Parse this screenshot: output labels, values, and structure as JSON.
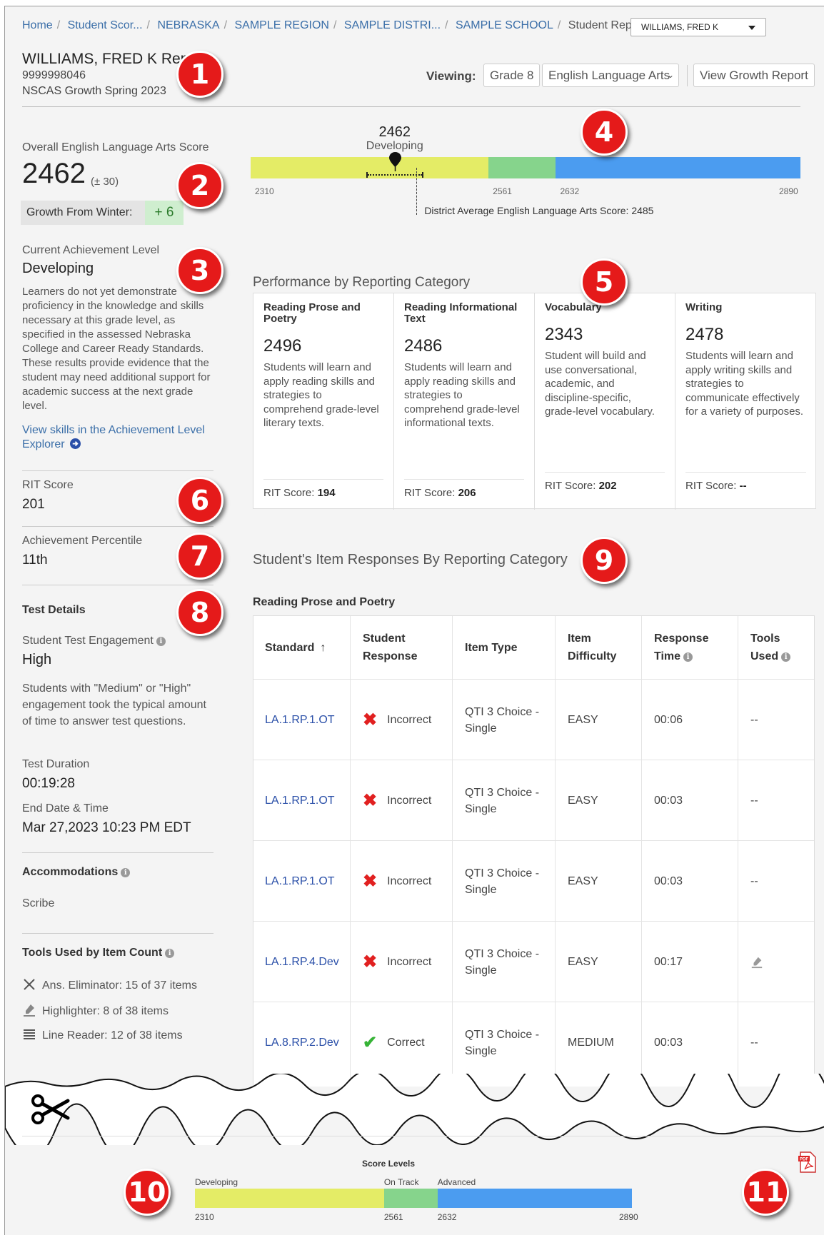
{
  "breadcrumb": [
    "Home",
    "Student Scor...",
    "NEBRASKA",
    "SAMPLE REGION",
    "SAMPLE DISTRI...",
    "SAMPLE SCHOOL"
  ],
  "breadcrumb_current": "Student Report:",
  "student_select": "WILLIAMS, FRED K",
  "header": {
    "title": "WILLIAMS, FRED K Report",
    "student_id": "9999998046",
    "test_name": "NSCAS Growth Spring 2023",
    "viewing_label": "Viewing:",
    "grade": "Grade 8",
    "subject": "English Language Arts",
    "growth_report_button": "View Growth Report"
  },
  "score": {
    "label": "Overall English Language Arts Score",
    "value": "2462",
    "error": "(± 30)",
    "growth_label": "Growth From Winter:",
    "growth_value": "+ 6",
    "marker_score": "2462",
    "marker_level": "Developing",
    "scale_min": 2310,
    "scale_max": 2890,
    "cuts": [
      2561,
      2632
    ],
    "student_score": 2462,
    "error_margin": 30,
    "district_average": 2485,
    "tick_labels": [
      "2310",
      "2561",
      "2632",
      "2890"
    ],
    "district_label": "District Average English Language Arts Score: 2485"
  },
  "colors": {
    "developing": "#e4ec66",
    "on_track": "#86d48c",
    "advanced": "#4b9cf0",
    "callout": "#e51a1a",
    "link": "#3a6ea8"
  },
  "achievement": {
    "label": "Current Achievement Level",
    "value": "Developing",
    "description": "Learners do not yet demonstrate proficiency in the knowledge and skills necessary at this grade level, as specified in the assessed Nebraska College and Career Ready Standards. These results provide evidence that the student may need additional support for academic success at the next grade level.",
    "link": "View skills in the Achievement Level Explorer"
  },
  "rit": {
    "label": "RIT Score",
    "value": "201"
  },
  "percentile": {
    "label": "Achievement Percentile",
    "value": "11th"
  },
  "test_details": {
    "heading": "Test Details",
    "engagement_label": "Student Test Engagement",
    "engagement_value": "High",
    "engagement_desc": "Students with \"Medium\" or \"High\" engagement took the typical amount of time to answer test questions.",
    "duration_label": "Test Duration",
    "duration_value": "00:19:28",
    "end_label": "End Date & Time",
    "end_value": "Mar 27,2023 10:23 PM EDT"
  },
  "accommodations": {
    "heading": "Accommodations",
    "value": "Scribe"
  },
  "tools": {
    "heading": "Tools Used by Item Count",
    "items": [
      {
        "icon": "ans-eliminator-icon",
        "label": "Ans. Eliminator: 15 of 37 items"
      },
      {
        "icon": "highlighter-icon",
        "label": "Highlighter: 8 of 38 items"
      },
      {
        "icon": "line-reader-icon",
        "label": "Line Reader: 12 of 38 items"
      }
    ]
  },
  "performance": {
    "heading": "Performance by Reporting Category",
    "categories": [
      {
        "title": "Reading Prose and Poetry",
        "score": "2496",
        "desc": "Students will learn and apply reading skills and strategies to comprehend grade-level literary texts.",
        "rit_label": "RIT Score:",
        "rit": "194"
      },
      {
        "title": "Reading Informational Text",
        "score": "2486",
        "desc": "Students will learn and apply reading skills and strategies to comprehend grade-level informational texts.",
        "rit_label": "RIT Score:",
        "rit": "206"
      },
      {
        "title": "Vocabulary",
        "score": "2343",
        "desc": "Student will build and use conversational, academic, and discipline-specific, grade-level vocabulary.",
        "rit_label": "RIT Score:",
        "rit": "202"
      },
      {
        "title": "Writing",
        "score": "2478",
        "desc": "Students will learn and apply writing skills and strategies to communicate effectively for a variety of purposes.",
        "rit_label": "RIT Score:",
        "rit": "--"
      }
    ]
  },
  "items": {
    "heading": "Student's Item Responses By Reporting Category",
    "subheading": "Reading Prose and Poetry",
    "columns": [
      "Standard",
      "Student Response",
      "Item Type",
      "Item Difficulty",
      "Response Time",
      "Tools Used"
    ],
    "rows": [
      {
        "standard": "LA.1.RP.1.OT",
        "response": "Incorrect",
        "correct": false,
        "type": "QTI 3 Choice - Single",
        "difficulty": "EASY",
        "time": "00:06",
        "tools": "--"
      },
      {
        "standard": "LA.1.RP.1.OT",
        "response": "Incorrect",
        "correct": false,
        "type": "QTI 3 Choice - Single",
        "difficulty": "EASY",
        "time": "00:03",
        "tools": "--"
      },
      {
        "standard": "LA.1.RP.1.OT",
        "response": "Incorrect",
        "correct": false,
        "type": "QTI 3 Choice - Single",
        "difficulty": "EASY",
        "time": "00:03",
        "tools": "--"
      },
      {
        "standard": "LA.1.RP.4.Dev",
        "response": "Incorrect",
        "correct": false,
        "type": "QTI 3 Choice - Single",
        "difficulty": "EASY",
        "time": "00:17",
        "tools": "highlighter-icon"
      },
      {
        "standard": "LA.8.RP.2.Dev",
        "response": "Correct",
        "correct": true,
        "type": "QTI 3 Choice - Single",
        "difficulty": "MEDIUM",
        "time": "00:03",
        "tools": "--"
      }
    ]
  },
  "score_levels": {
    "title": "Score Levels",
    "levels": [
      "Developing",
      "On Track",
      "Advanced"
    ],
    "ticks": [
      "2310",
      "2561",
      "2632",
      "2890"
    ]
  },
  "callouts": [
    "1",
    "2",
    "3",
    "4",
    "5",
    "6",
    "7",
    "8",
    "9",
    "10",
    "11"
  ]
}
